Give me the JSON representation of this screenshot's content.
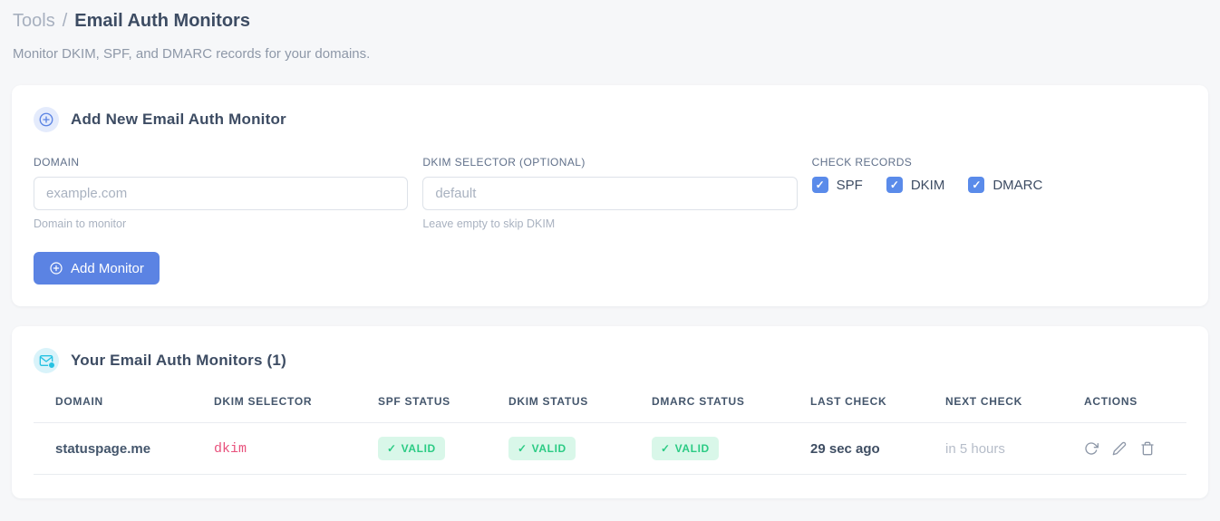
{
  "page": {
    "breadcrumb": {
      "section": "Tools",
      "separator": "/",
      "current": "Email Auth Monitors"
    },
    "subtitle": "Monitor DKIM, SPF, and DMARC records for your domains."
  },
  "add_card": {
    "title": "Add New Email Auth Monitor",
    "fields": {
      "domain": {
        "label": "DOMAIN",
        "placeholder": "example.com",
        "value": "",
        "helper": "Domain to monitor"
      },
      "dkim_selector": {
        "label": "DKIM SELECTOR (OPTIONAL)",
        "placeholder": "default",
        "value": "",
        "helper": "Leave empty to skip DKIM"
      }
    },
    "check_records": {
      "label": "CHECK RECORDS",
      "check_glyph": "✓",
      "options": [
        {
          "label": "SPF",
          "checked": true
        },
        {
          "label": "DKIM",
          "checked": true
        },
        {
          "label": "DMARC",
          "checked": true
        }
      ]
    },
    "submit_label": "Add Monitor"
  },
  "monitors_card": {
    "title": "Your Email Auth Monitors (1)",
    "check_glyph": "✓",
    "table": {
      "headers": [
        "DOMAIN",
        "DKIM SELECTOR",
        "SPF STATUS",
        "DKIM STATUS",
        "DMARC STATUS",
        "LAST CHECK",
        "NEXT CHECK",
        "ACTIONS"
      ],
      "rows": [
        {
          "domain": "statuspage.me",
          "dkim_selector": "dkim",
          "spf_status": "VALID",
          "dkim_status": "VALID",
          "dmarc_status": "VALID",
          "last_check": "29 sec ago",
          "next_check": "in 5 hours"
        }
      ]
    }
  },
  "icons": {
    "add_header": "plus-circle-icon",
    "monitors_header": "envelope-check-icon",
    "button": "plus-circle-icon",
    "row_actions": [
      "refresh-icon",
      "edit-pencil-icon",
      "trash-icon"
    ]
  },
  "colors": {
    "accent_blue": "#5b83e3",
    "checkbox_blue": "#5a8bea",
    "icon_cyan": "#26c2e2",
    "badge_bg": "#d9f7e9",
    "badge_text": "#2bcb84",
    "code_pink": "#e8517c",
    "page_bg": "#f6f7f9"
  }
}
